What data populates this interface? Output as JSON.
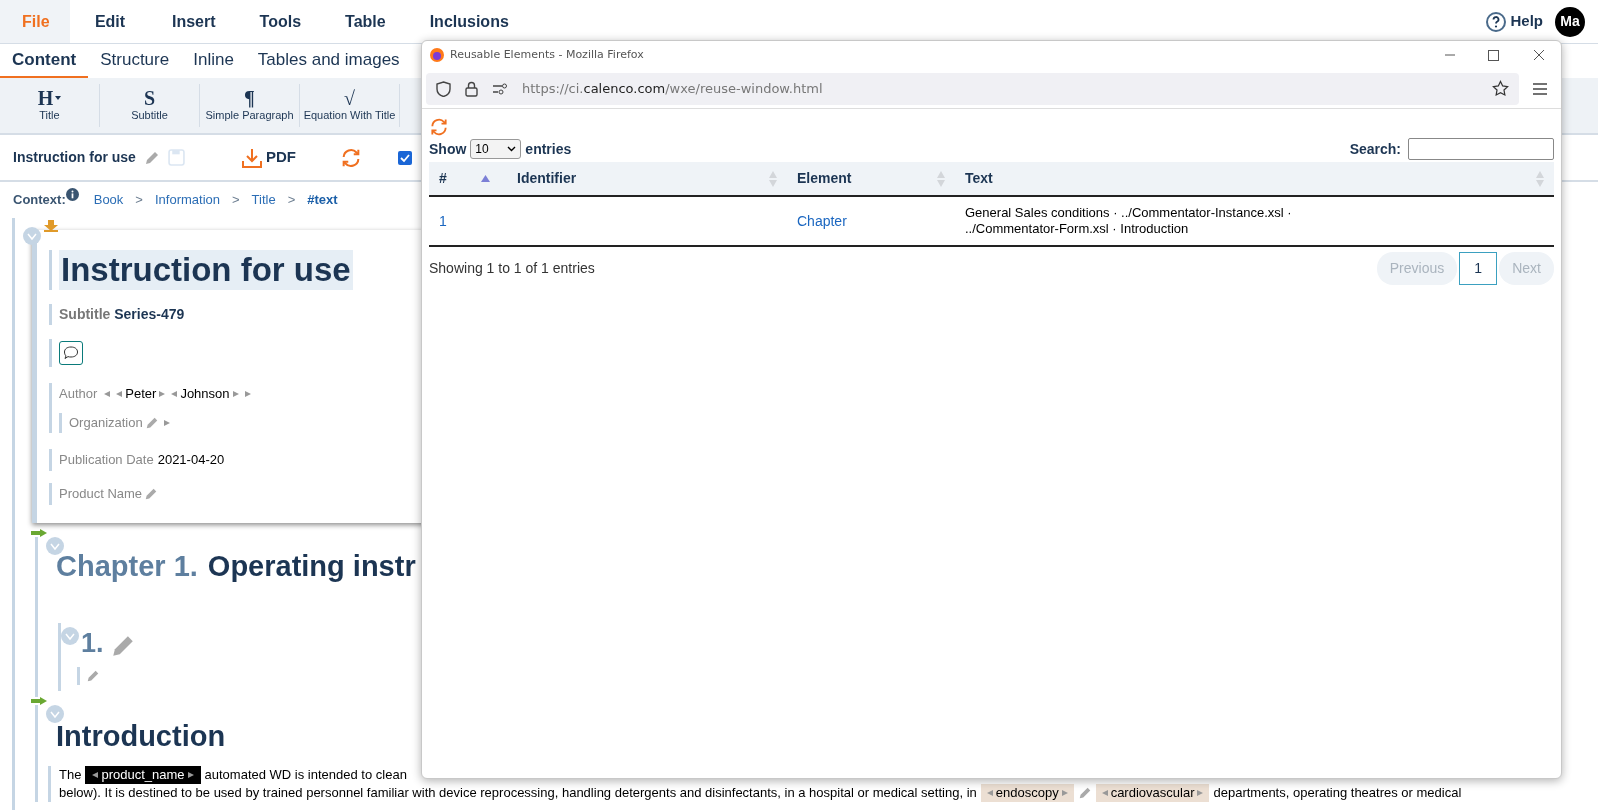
{
  "menu": [
    {
      "label": "File",
      "selected": true
    },
    {
      "label": "Edit",
      "selected": false
    },
    {
      "label": "Insert",
      "selected": false
    },
    {
      "label": "Tools",
      "selected": false
    },
    {
      "label": "Table",
      "selected": false
    },
    {
      "label": "Inclusions",
      "selected": false
    }
  ],
  "help": "Help",
  "avatar": "Ma",
  "ribbon_tabs": [
    {
      "label": "Content",
      "selected": true
    },
    {
      "label": "Structure",
      "selected": false
    },
    {
      "label": "Inline",
      "selected": false
    },
    {
      "label": "Tables and images",
      "selected": false
    }
  ],
  "ribbon_tools": [
    {
      "glyph": "H",
      "label": "Title",
      "dropdown": true
    },
    {
      "glyph": "S",
      "label": "Subtitle",
      "dropdown": false
    },
    {
      "glyph": "¶",
      "label": "Simple Paragraph",
      "dropdown": false
    },
    {
      "glyph": "√",
      "label": "Equation With Title",
      "dropdown": false
    }
  ],
  "doc_bar": {
    "title": "Instruction for use",
    "pdf": "PDF",
    "checked": true
  },
  "context": {
    "label": "Context:",
    "separator": ">",
    "path": [
      {
        "label": "Book",
        "current": false
      },
      {
        "label": "Information",
        "current": false
      },
      {
        "label": "Title",
        "current": false
      },
      {
        "label": "#text",
        "current": true
      }
    ]
  },
  "document": {
    "title": "Instruction for use",
    "subtitle_label": "Subtitle",
    "subtitle": "Series-479",
    "author_label": "Author",
    "authors": [
      "Peter",
      "Johnson"
    ],
    "organization_label": "Organization",
    "publication_date_label": "Publication Date",
    "publication_date": "2021-04-20",
    "product_name_label": "Product Name",
    "chapter_number": "Chapter 1.",
    "chapter_title": "Operating instr",
    "section_number": "1.",
    "intro_title": "Introduction",
    "line_1": {
      "before": "The",
      "tag": "product_name",
      "after": "automated WD is intended to clean"
    },
    "line_2": {
      "before": "below). It is destined to be used by trained personnel familiar with device reprocessing, handling detergents and disinfectants, in a hospital or medical setting, in",
      "tags": [
        "endoscopy",
        "cardiovascular"
      ],
      "after": "departments, operating theatres or medical"
    }
  },
  "popup": {
    "title": "Reusable Elements - Mozilla Firefox",
    "url_prefix": "https://ci.",
    "url_domain": "calenco.com",
    "url_path": "/wxe/reuse-window.html",
    "show_label": "Show",
    "page_size": "10",
    "entries_label": "entries",
    "search_label": "Search:",
    "columns": [
      {
        "label": "#",
        "sorted": true
      },
      {
        "label": "Identifier",
        "sorted": false
      },
      {
        "label": "Element",
        "sorted": false
      },
      {
        "label": "Text",
        "sorted": false
      }
    ],
    "rows": [
      {
        "number": "1",
        "element": "Chapter",
        "text": "General Sales conditions · ../Commentator-Instance.xsl · ../Commentator-Form.xsl · Introduction"
      }
    ],
    "info": "Showing 1 to 1 of 1 entries",
    "previous": {
      "label": "Previous",
      "disabled": true
    },
    "pages": [
      {
        "label": "1",
        "selected": true
      }
    ],
    "next": {
      "label": "Next",
      "disabled": true
    }
  }
}
